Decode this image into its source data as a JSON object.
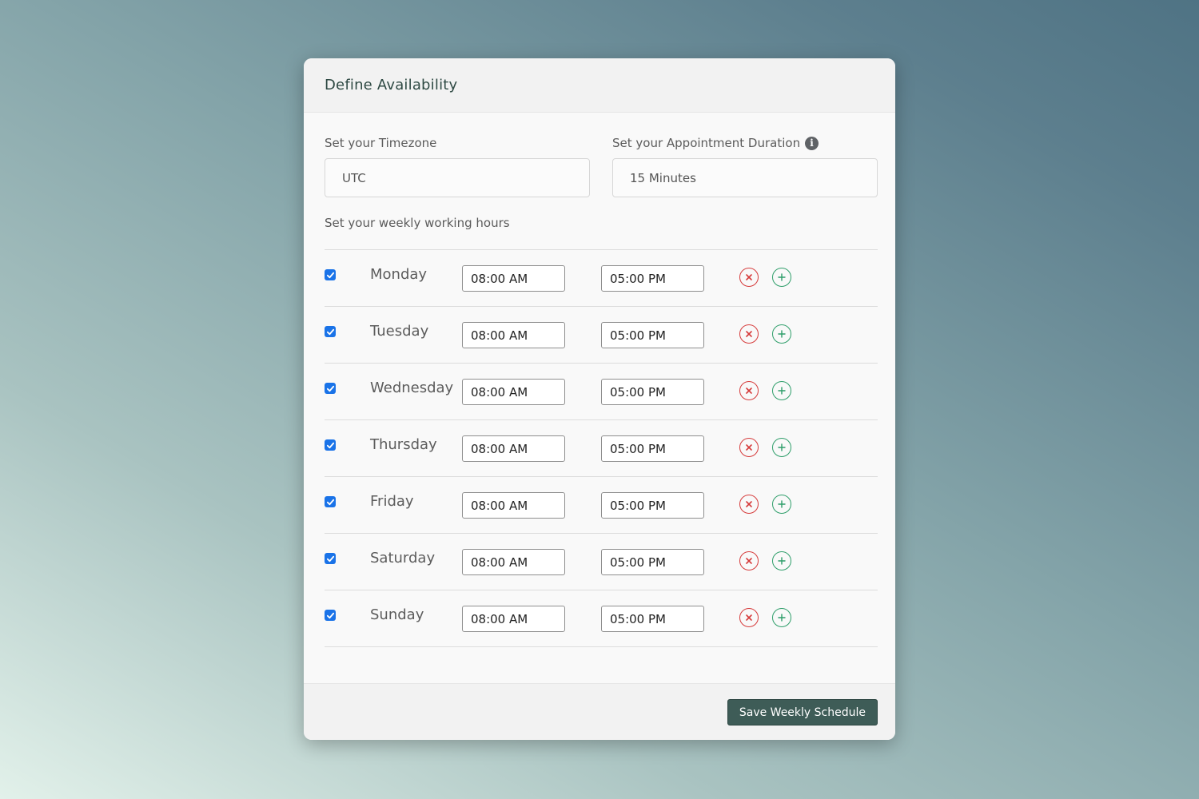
{
  "card": {
    "title": "Define Availability"
  },
  "timezone": {
    "label": "Set your Timezone",
    "value": "UTC"
  },
  "duration": {
    "label": "Set your Appointment Duration",
    "value": "15 Minutes",
    "info_icon": "info-icon"
  },
  "weekly": {
    "label": "Set your weekly working hours",
    "days": [
      {
        "name": "Monday",
        "enabled": true,
        "start": "08:00 AM",
        "end": "05:00 PM"
      },
      {
        "name": "Tuesday",
        "enabled": true,
        "start": "08:00 AM",
        "end": "05:00 PM"
      },
      {
        "name": "Wednesday",
        "enabled": true,
        "start": "08:00 AM",
        "end": "05:00 PM"
      },
      {
        "name": "Thursday",
        "enabled": true,
        "start": "08:00 AM",
        "end": "05:00 PM"
      },
      {
        "name": "Friday",
        "enabled": true,
        "start": "08:00 AM",
        "end": "05:00 PM"
      },
      {
        "name": "Saturday",
        "enabled": true,
        "start": "08:00 AM",
        "end": "05:00 PM"
      },
      {
        "name": "Sunday",
        "enabled": true,
        "start": "08:00 AM",
        "end": "05:00 PM"
      }
    ]
  },
  "footer": {
    "save_label": "Save Weekly Schedule"
  },
  "colors": {
    "accent": "#3e5c57",
    "checkbox": "#1a73e8",
    "remove": "#d63b3b",
    "add": "#2e9e6a"
  }
}
